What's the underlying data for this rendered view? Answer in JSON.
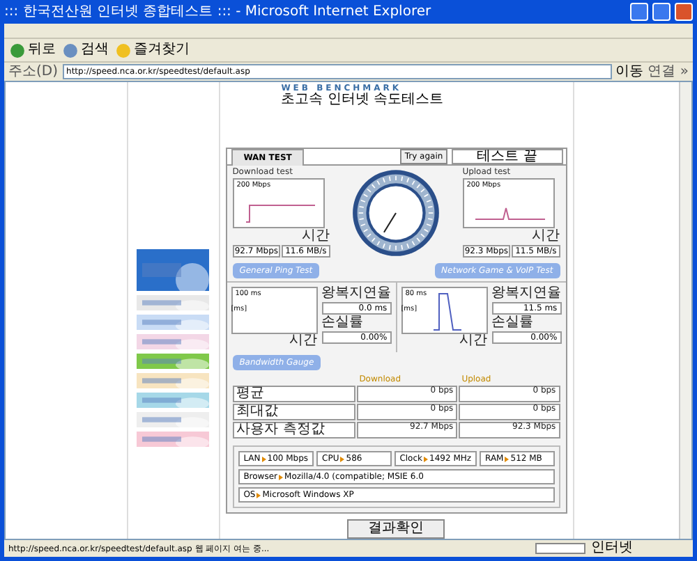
{
  "window": {
    "title": "::: 한국전산원 인터넷 종합테스트 ::: - Microsoft Internet Explorer"
  },
  "toolbar": {
    "buttons": [
      {
        "label": "뒤로"
      },
      {
        "label": "검색"
      },
      {
        "label": "즐겨찾기"
      }
    ]
  },
  "address_bar": {
    "label": "주소(D)",
    "url": "http://speed.nca.or.kr/speedtest/default.asp",
    "go": "이동",
    "links": "연결 »"
  },
  "page": {
    "brand": "WEB BENCHMARK",
    "heading": "초고속 인터넷 속도테스트"
  },
  "test_panel": {
    "tab": "WAN TEST",
    "try_again": "Try again",
    "status": "테스트 끝",
    "speed_tests": [
      {
        "title": "Download test",
        "scale": "200 Mbps",
        "time": "시간",
        "mbps": "92.7 Mbps",
        "mbs": "11.6 MB/s"
      },
      {
        "title": "Upload test",
        "scale": "200 Mbps",
        "time": "시간",
        "mbps": "92.3 Mbps",
        "mbs": "11.5 MB/s"
      }
    ],
    "sections": [
      "General Ping Test",
      "Network Game & VoIP Test"
    ],
    "ping_tests": [
      {
        "scale": "100 ms",
        "axis": "[ms]",
        "time": "시간",
        "rtt_label": "왕복지연율",
        "rtt": "0.0 ms",
        "loss_label": "손실률",
        "loss": "0.00%"
      },
      {
        "scale": "80 ms",
        "axis": "[ms]",
        "time": "시간",
        "rtt_label": "왕복지연율",
        "rtt": "11.5 ms",
        "loss_label": "손실률",
        "loss": "0.00%"
      }
    ],
    "bandwidth_title": "Bandwidth Gauge",
    "table": {
      "columns": [
        "Download",
        "Upload"
      ],
      "rows": [
        {
          "label": "평균",
          "download": "0 bps",
          "upload": "0 bps"
        },
        {
          "label": "최대값",
          "download": "0 bps",
          "upload": "0 bps"
        },
        {
          "label": "사용자 측정값",
          "download": "92.7 Mbps",
          "upload": "92.3 Mbps"
        }
      ]
    },
    "info": [
      {
        "label": "LAN",
        "value": "100 Mbps"
      },
      {
        "label": "CPU",
        "value": "586"
      },
      {
        "label": "Clock",
        "value": "1492 MHz"
      },
      {
        "label": "RAM",
        "value": "512 MB"
      },
      {
        "label": "Browser",
        "value": "Mozilla/4.0 (compatible; MSIE 6.0"
      },
      {
        "label": "OS",
        "value": "Microsoft Windows XP"
      }
    ],
    "result_button": "결과확인"
  },
  "status_bar": {
    "text": "http://speed.nca.or.kr/speedtest/default.asp 웹 페이지 여는 중...",
    "zone": "인터넷"
  }
}
